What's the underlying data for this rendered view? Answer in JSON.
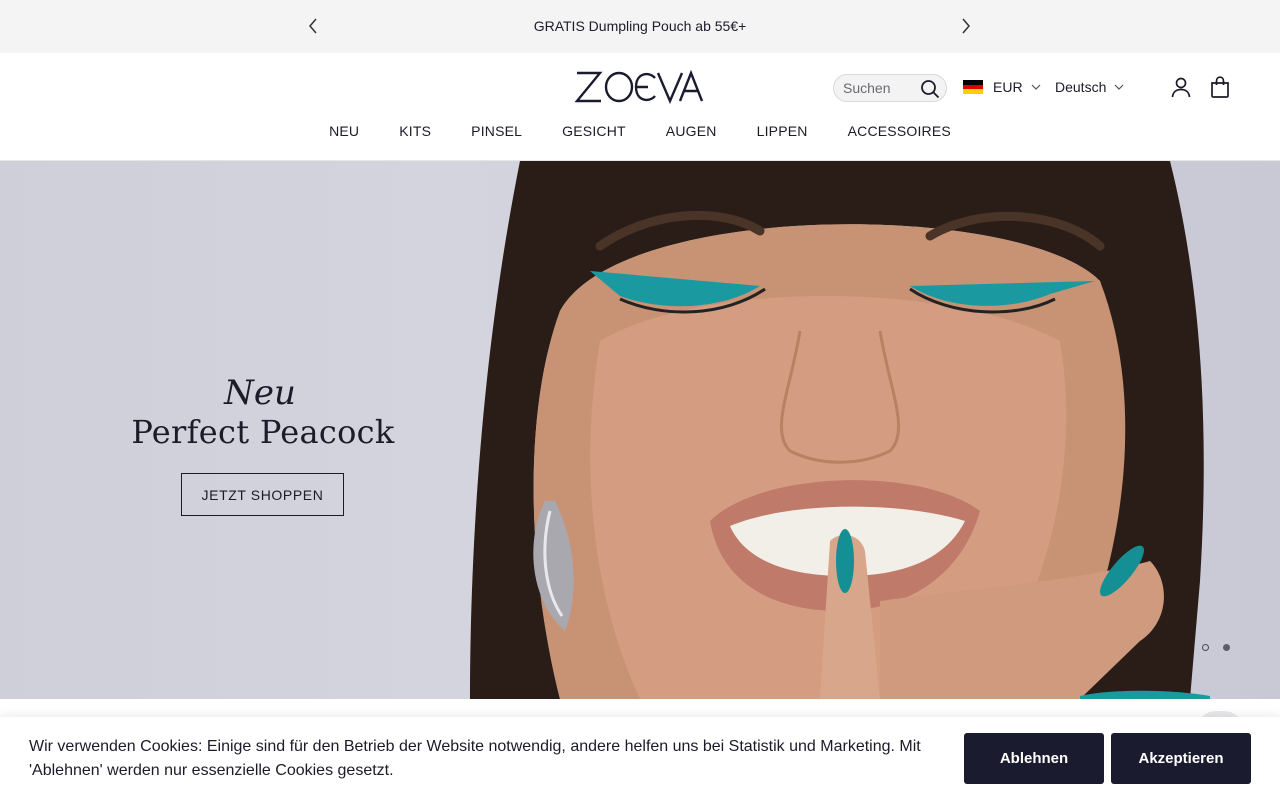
{
  "announcement": {
    "text": "GRATIS Dumpling Pouch ab 55€+",
    "prev_icon": "chevron-left-icon",
    "next_icon": "chevron-right-icon"
  },
  "header": {
    "logo_text": "ZOEVA",
    "search": {
      "placeholder": "Suchen",
      "icon": "search-icon"
    },
    "currency": {
      "flag": "germany-flag-icon",
      "label": "EUR"
    },
    "language": {
      "label": "Deutsch"
    },
    "account_icon": "user-icon",
    "bag_icon": "shopping-bag-icon"
  },
  "nav": {
    "items": [
      "NEU",
      "KITS",
      "PINSEL",
      "GESICHT",
      "AUGEN",
      "LIPPEN",
      "ACCESSOIRES"
    ]
  },
  "hero": {
    "eyebrow": "Neu",
    "headline": "Perfect Peacock",
    "cta": "JETZT SHOPPEN",
    "slides_total": 2,
    "active_slide": 1
  },
  "cookie": {
    "text": "Wir verwenden Cookies: Einige sind für den Betrieb der Website notwendig, andere helfen uns bei Statistik und Marketing. Mit 'Ablehnen' werden nur essenzielle Cookies gesetzt.",
    "decline": "Ablehnen",
    "accept": "Akzeptieren"
  },
  "colors": {
    "text": "#1b1b2a",
    "button": "#1b1b2f",
    "announce_bg": "#f4f4f4",
    "accent_teal": "#1a9aa0",
    "flag": [
      "#000000",
      "#dd0000",
      "#ffce00"
    ]
  }
}
